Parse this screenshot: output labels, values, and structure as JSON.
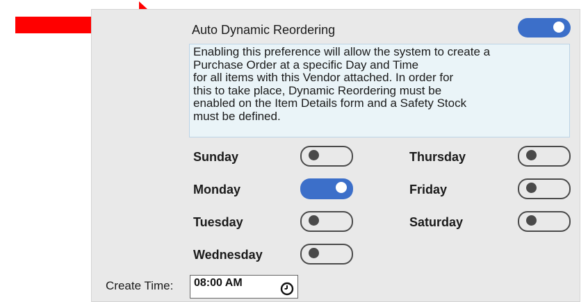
{
  "title": "Auto Dynamic Reordering",
  "auto_reorder_enabled": true,
  "description_lines": [
    "Enabling this preference will allow the system to create a",
    "Purchase Order at a specific Day and Time",
    "for all items with this Vendor attached. In order for",
    "this to take place, Dynamic Reordering must be",
    "enabled on the Item Details form and a Safety Stock",
    "must be defined."
  ],
  "days": [
    {
      "label": "Sunday",
      "enabled": false
    },
    {
      "label": "Monday",
      "enabled": true
    },
    {
      "label": "Tuesday",
      "enabled": false
    },
    {
      "label": "Wednesday",
      "enabled": false
    },
    {
      "label": "Thursday",
      "enabled": false
    },
    {
      "label": "Friday",
      "enabled": false
    },
    {
      "label": "Saturday",
      "enabled": false
    }
  ],
  "create_time": {
    "label": "Create Time:",
    "value": "08:00 AM",
    "icon": "clock-icon"
  },
  "colors": {
    "arrow": "#ff0000",
    "toggle_on": "#3c6fc9",
    "panel_bg": "#e9e9e9",
    "description_bg": "#eaf4f8"
  }
}
